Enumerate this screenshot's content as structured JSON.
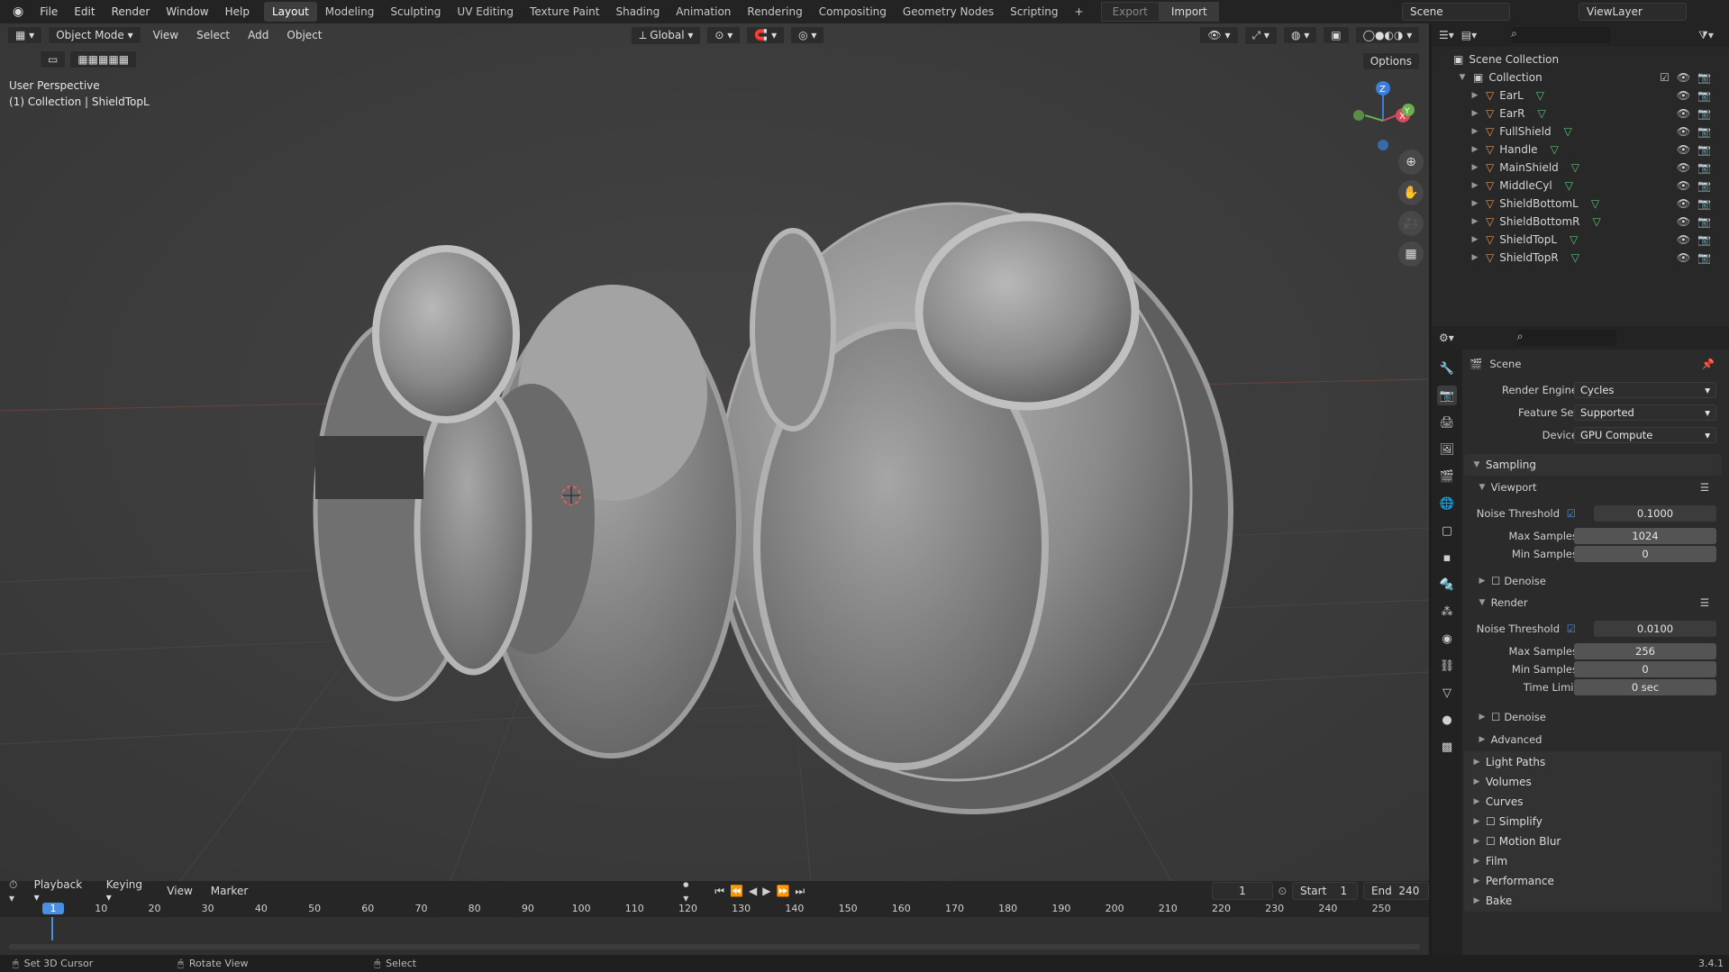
{
  "menu": [
    "File",
    "Edit",
    "Render",
    "Window",
    "Help"
  ],
  "workspaces": [
    "Layout",
    "Modeling",
    "Sculpting",
    "UV Editing",
    "Texture Paint",
    "Shading",
    "Animation",
    "Rendering",
    "Compositing",
    "Geometry Nodes",
    "Scripting"
  ],
  "add_tab": "+",
  "export_label": "Export",
  "import_label": "Import",
  "scene_name": "Scene",
  "view_layer": "ViewLayer",
  "viewport": {
    "mode": "Object Mode",
    "menus": [
      "View",
      "Select",
      "Add",
      "Object"
    ],
    "orientation": "Global",
    "perspective_label": "User Perspective",
    "collection_label": "(1) Collection | ShieldTopL",
    "options": "Options",
    "gizmo": {
      "z": "Z",
      "y": "Y",
      "x": "X"
    }
  },
  "outliner": {
    "root": "Scene Collection",
    "collection": "Collection",
    "items": [
      "EarL",
      "EarR",
      "FullShield",
      "Handle",
      "MainShield",
      "MiddleCyl",
      "ShieldBottomL",
      "ShieldBottomR",
      "ShieldTopL",
      "ShieldTopR"
    ]
  },
  "properties": {
    "context": "Scene",
    "render_engine_label": "Render Engine",
    "render_engine": "Cycles",
    "feature_set_label": "Feature Set",
    "feature_set": "Supported",
    "device_label": "Device",
    "device": "GPU Compute",
    "sampling": "Sampling",
    "viewport_sub": "Viewport",
    "noise_threshold_label": "Noise Threshold",
    "vp_noise_threshold": "0.1000",
    "max_samples_label": "Max Samples",
    "vp_max_samples": "1024",
    "min_samples_label": "Min Samples",
    "vp_min_samples": "0",
    "denoise": "Denoise",
    "render_sub": "Render",
    "r_noise_threshold": "0.0100",
    "r_max_samples": "256",
    "r_min_samples": "0",
    "time_limit_label": "Time Limit",
    "r_time_limit": "0 sec",
    "advanced": "Advanced",
    "sections": [
      "Light Paths",
      "Volumes",
      "Curves",
      "Simplify",
      "Motion Blur",
      "Film",
      "Performance",
      "Bake"
    ]
  },
  "timeline": {
    "menus": [
      "Playback",
      "Keying",
      "View",
      "Marker"
    ],
    "current_frame": "1",
    "start_label": "Start",
    "start": "1",
    "end_label": "End",
    "end": "240",
    "ticks": [
      "1",
      "10",
      "20",
      "30",
      "40",
      "50",
      "60",
      "70",
      "80",
      "90",
      "100",
      "110",
      "120",
      "130",
      "140",
      "150",
      "160",
      "170",
      "180",
      "190",
      "200",
      "210",
      "220",
      "230",
      "240",
      "250"
    ]
  },
  "status": {
    "left": "Set 3D Cursor",
    "middle": "Rotate View",
    "right": "Select",
    "version": "3.4.1"
  }
}
